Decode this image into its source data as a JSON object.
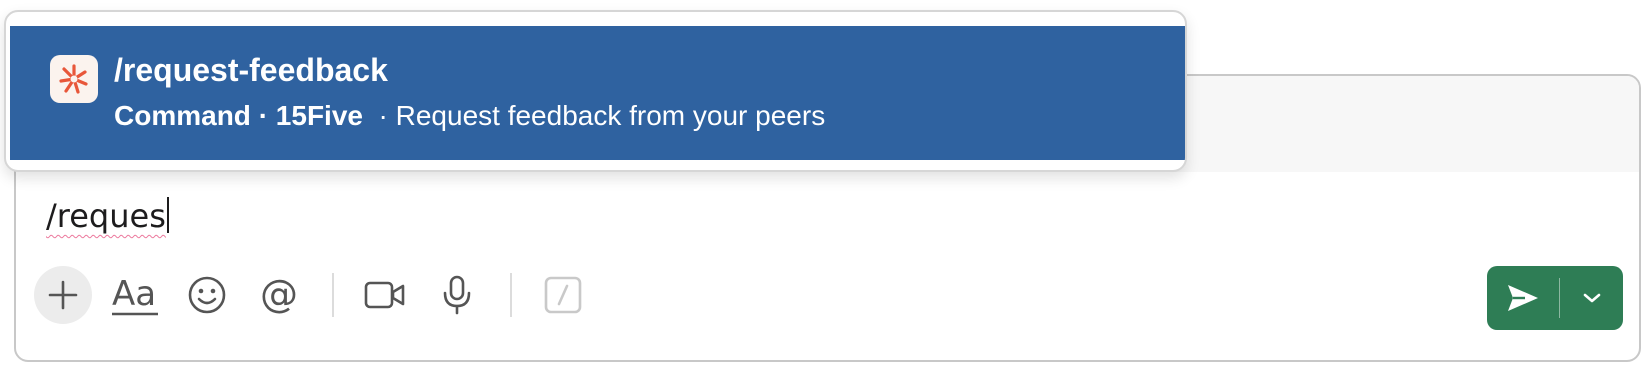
{
  "autocomplete": {
    "suggestion": {
      "command": "/request-feedback",
      "type_label": "Command",
      "app_name": "15Five",
      "description": "Request feedback from your peers",
      "separator": "·",
      "icon": "15five-app-icon"
    },
    "highlight_color": "#2f62a0"
  },
  "composer": {
    "input_value": "/reques",
    "toolbar": [
      {
        "icon": "plus-icon"
      },
      {
        "icon": "text-format-icon",
        "label": "Aa"
      },
      {
        "icon": "emoji-icon"
      },
      {
        "icon": "mention-icon",
        "label": "@"
      },
      {
        "icon": "video-icon"
      },
      {
        "icon": "microphone-icon"
      },
      {
        "icon": "slash-command-icon"
      }
    ],
    "send": {
      "icon": "send-icon",
      "chevron_icon": "chevron-down-icon",
      "color": "#2e7d55"
    }
  }
}
